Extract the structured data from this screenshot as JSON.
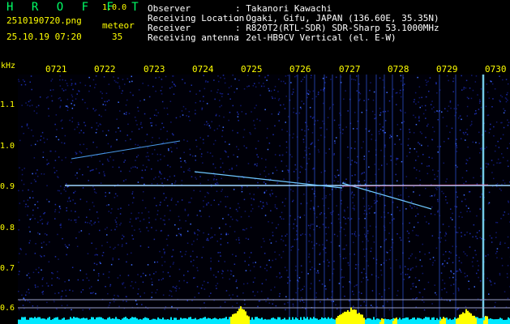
{
  "header": {
    "app_title": "H R O F F T",
    "version": "1.0.0",
    "filename": "2510190720.png",
    "mode": "meteor",
    "timestamp": "25.10.19 07:20",
    "count": "35",
    "fields": [
      {
        "label": "Observer",
        "value": ": Takanori Kawachi"
      },
      {
        "label": "Receiving Location",
        "value": ": Ogaki, Gifu, JAPAN (136.60E, 35.35N)"
      },
      {
        "label": "Receiver",
        "value": ": R820T2(RTL-SDR) SDR-Sharp 53.1000MHz"
      },
      {
        "label": "Receiving antenna",
        "value": ": 2el-HB9CV Vertical (el. E-W)"
      }
    ]
  },
  "time_axis": [
    "0721",
    "0722",
    "0723",
    "0724",
    "0725",
    "0726",
    "0727",
    "0728",
    "0729",
    "0730"
  ],
  "freq_axis": {
    "unit": "kHz",
    "labels": [
      "1.1",
      "1.0",
      "0.9",
      "0.8",
      "0.7",
      "0.6"
    ],
    "values": [
      1.1,
      1.0,
      0.9,
      0.8,
      0.7,
      0.6
    ]
  },
  "colors": {
    "background": "#000000",
    "title": "#00ff66",
    "labels": "#ffff00",
    "info_text": "#ffffff",
    "noise": "#1a2a9a",
    "carrier": "#9fd8ff",
    "burst": "#ffff00",
    "floor": "#00e8ff"
  }
}
